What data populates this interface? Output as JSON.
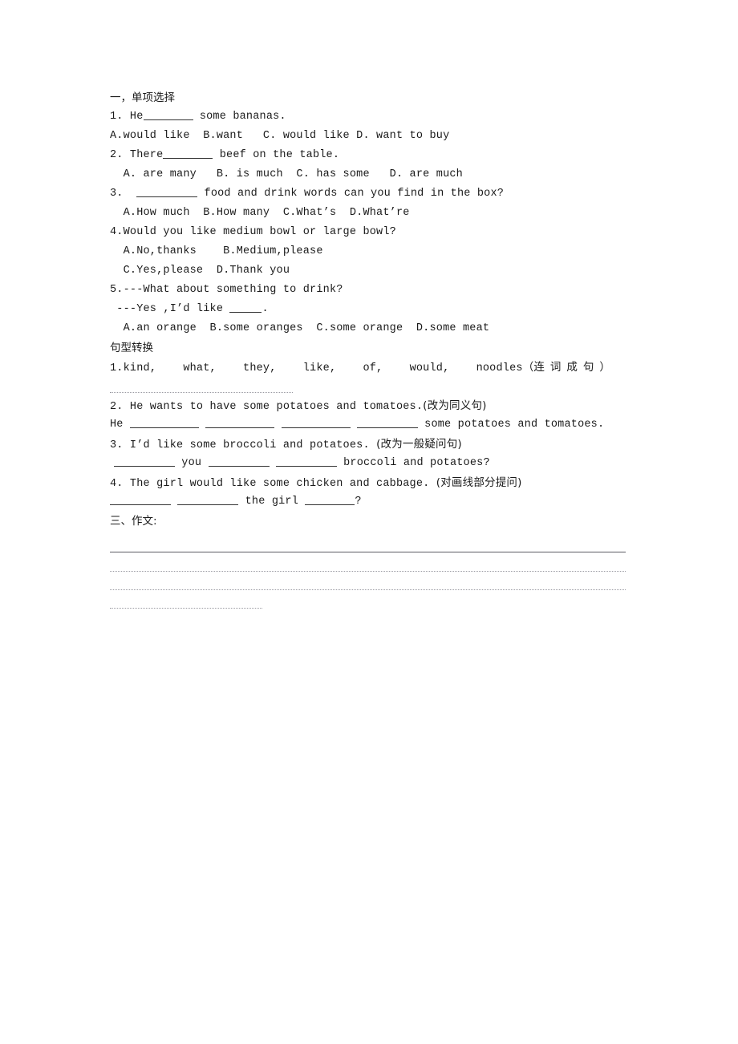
{
  "document": {
    "sections": [
      {
        "id": "section-one",
        "heading": "一，单项选择",
        "items": [
          {
            "stem": "1. He",
            "stem_after": " some bananas.",
            "options": "A.would like  B.want   C. would like D. want to buy"
          },
          {
            "stem": "2. There",
            "stem_after": " beef on the table.",
            "options": "  A. are many   B. is much  C. has some   D. are much"
          },
          {
            "stem": "3.  ",
            "stem_after": " food and drink words can you find in the box?",
            "options": "  A.How much  B.How many  C.What’s  D.What’re"
          },
          {
            "stem": "4.Would you like medium bowl or large bowl?",
            "options": "  A.No,thanks    B.Medium,please",
            "options2": "  C.Yes,please  D.Thank you"
          },
          {
            "stem": "5.---What about something to drink?",
            "stem2": " ---Yes ,I’d like ",
            "stem2_after": ".",
            "options": "  A.an orange  B.some oranges  C.some orange  D.some meat"
          }
        ]
      },
      {
        "id": "section-two",
        "heading": "句型转换",
        "items": [
          {
            "number": "1.",
            "words": "kind,    what,    they,    like,    of,    would,    noodles",
            "paren_open": "（",
            "instruction": "连词成句",
            "paren_close": "）"
          },
          {
            "stem": "2. He wants to have some potatoes and tomatoes.",
            "instruction": "(改为同义句)",
            "answer_prefix": "He ",
            "answer_suffix": " some potatoes and tomatoes."
          },
          {
            "stem": "3. I’d like some broccoli and potatoes. ",
            "instruction": "(改为一般疑问句)",
            "answer_mid": " you ",
            "answer_suffix": " broccoli and potatoes?"
          },
          {
            "stem": "4. The girl would like some chicken and cabbage. ",
            "instruction": "(对画线部分提问)",
            "answer_mid": " the girl ",
            "answer_suffix": "?"
          }
        ]
      },
      {
        "id": "section-three",
        "heading": "三、作文:"
      }
    ]
  }
}
